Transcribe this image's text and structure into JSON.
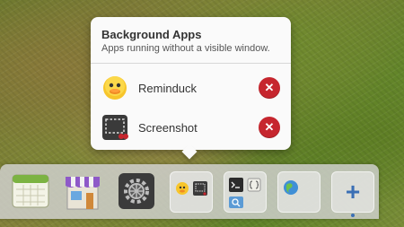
{
  "popover": {
    "title": "Background Apps",
    "subtitle": "Apps running without a visible window.",
    "apps": [
      {
        "label": "Reminduck",
        "icon": "duck-icon"
      },
      {
        "label": "Screenshot",
        "icon": "screenshot-icon"
      }
    ],
    "close_glyph": "✕"
  },
  "dock": {
    "items": [
      {
        "name": "calendar-icon"
      },
      {
        "name": "appcenter-store-icon"
      },
      {
        "name": "system-settings-icon"
      },
      {
        "name": "background-apps-group"
      },
      {
        "name": "terminal-code-files-group"
      },
      {
        "name": "web-browser-icon"
      },
      {
        "name": "add-launcher-button",
        "glyph": "+"
      }
    ]
  },
  "colors": {
    "close_red": "#c6262e",
    "popover_bg": "#fafafa",
    "accent_blue": "#3a6fb5"
  }
}
